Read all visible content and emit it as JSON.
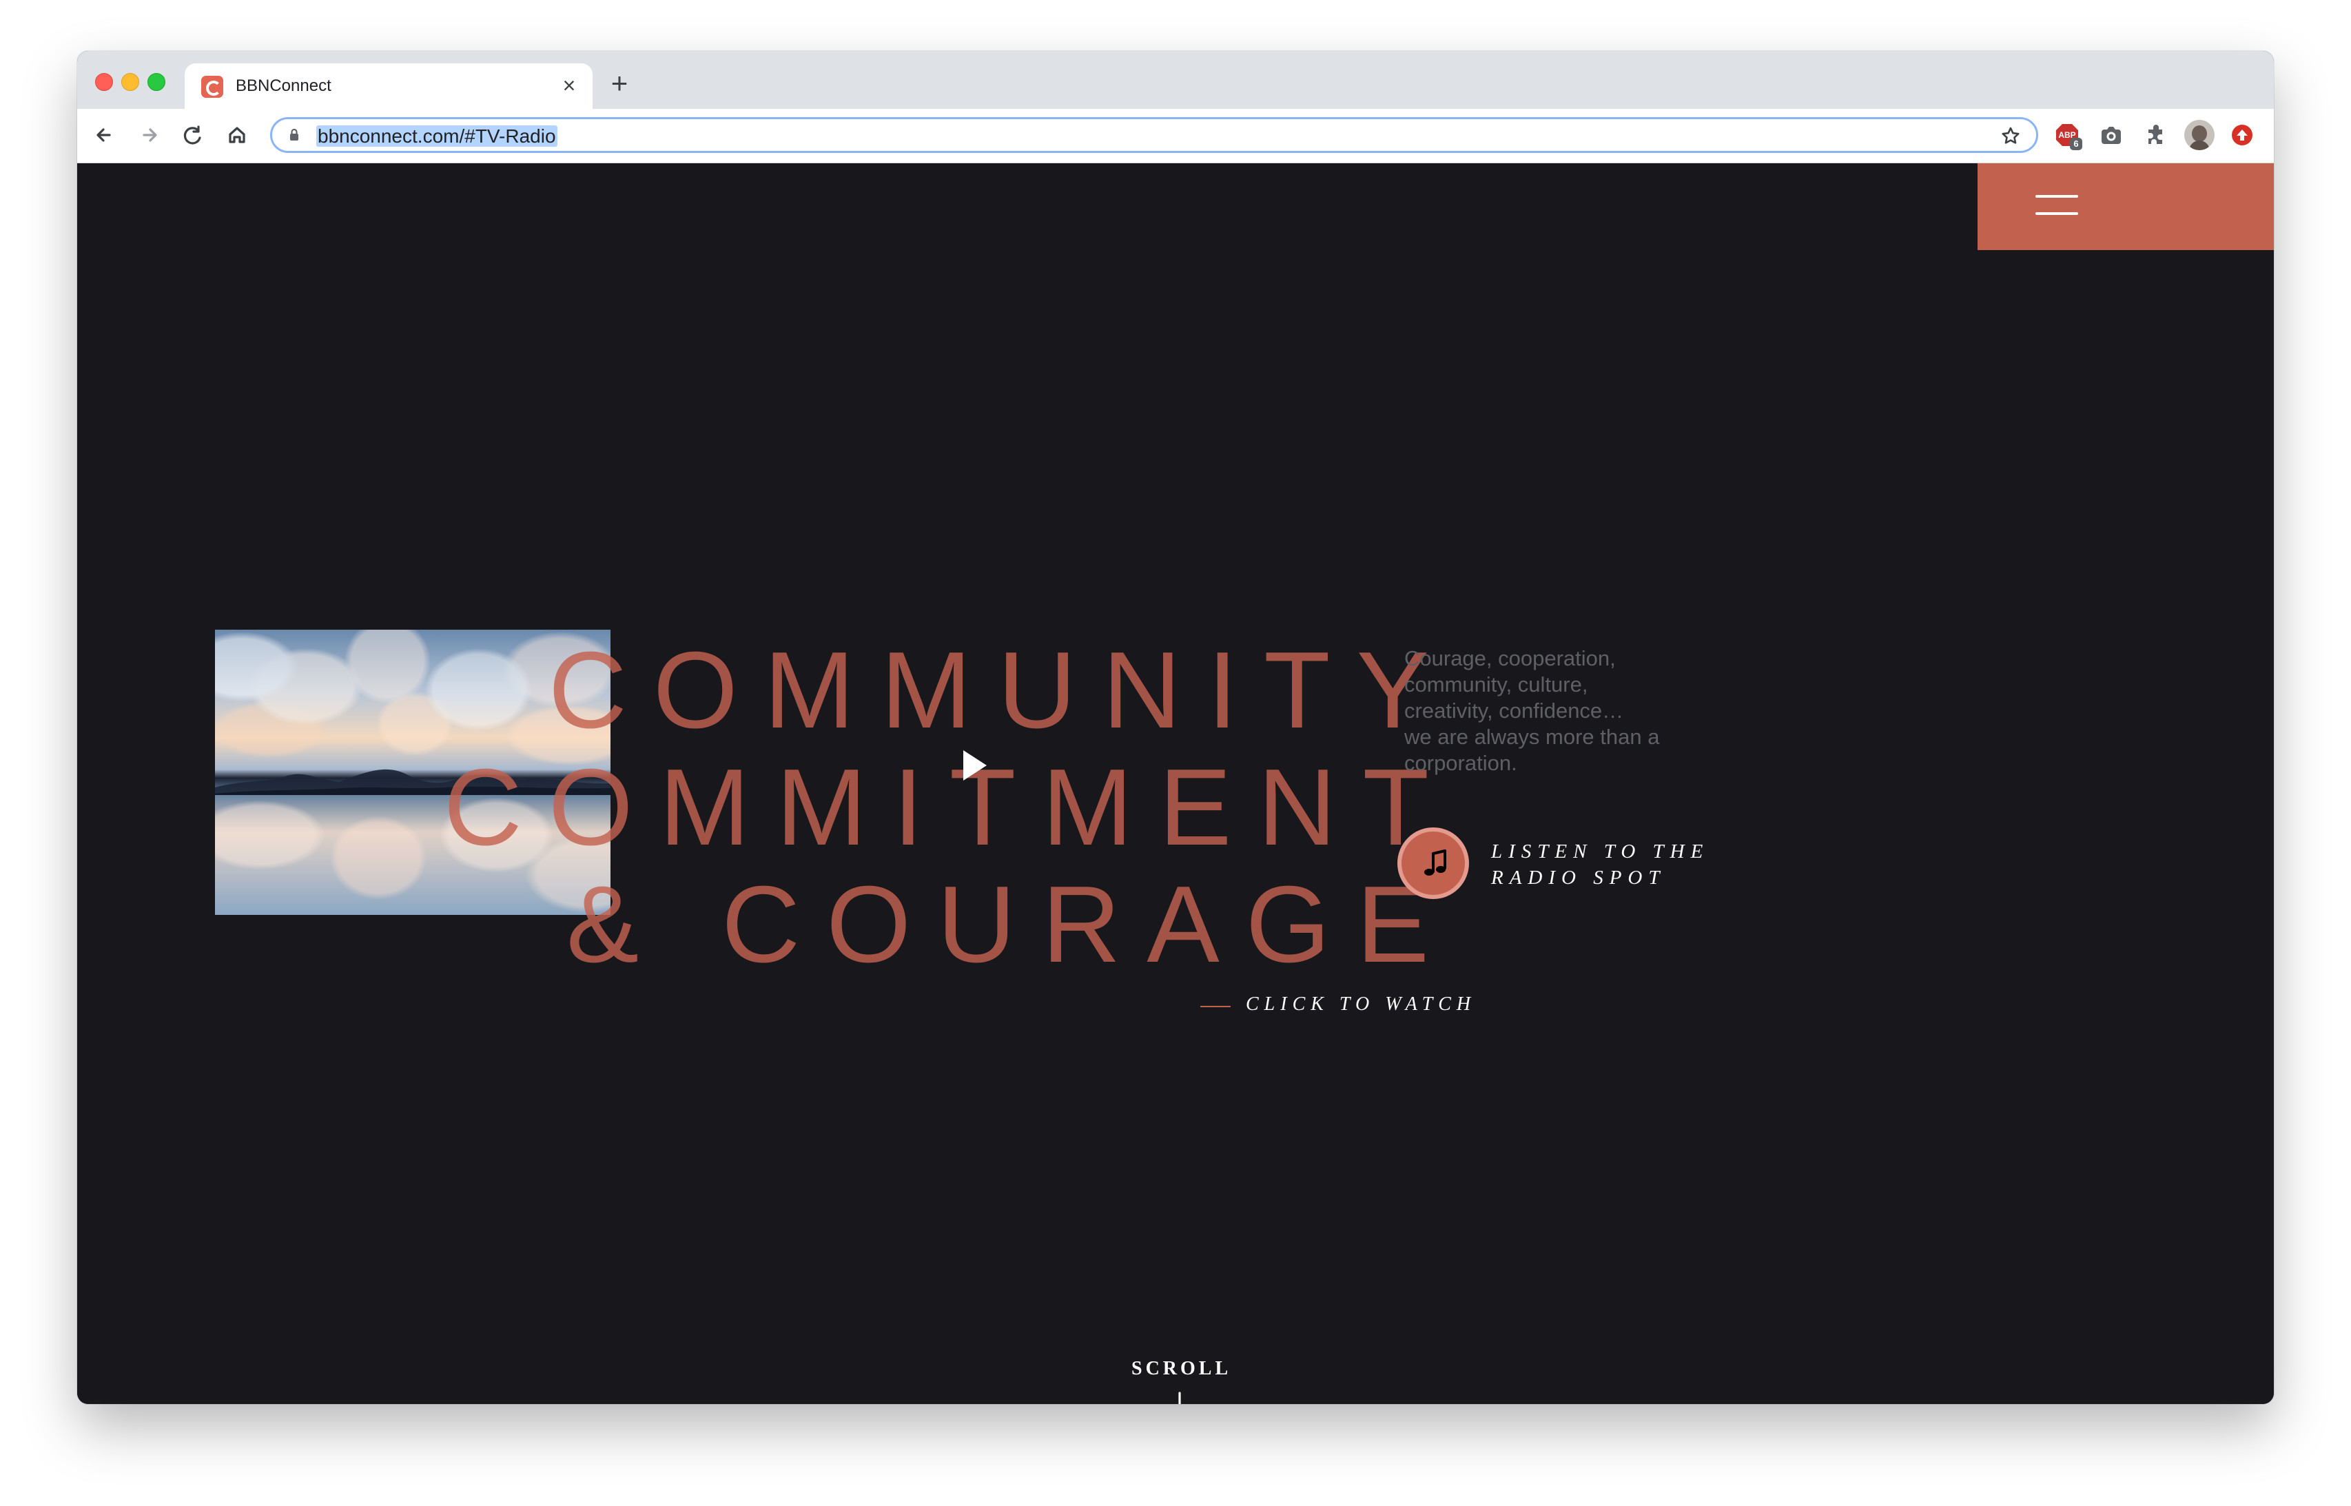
{
  "browser": {
    "tab_title": "BBNConnect",
    "close_symbol": "×",
    "new_tab_symbol": "+",
    "url": "bbnconnect.com/#TV-Radio",
    "ad_block_count": "6",
    "icons": {
      "favicon": "bbn-favicon-icon",
      "back": "arrow-left-icon",
      "forward": "arrow-right-icon",
      "reload": "reload-icon",
      "home": "home-icon",
      "secure": "lock-icon",
      "bookmark": "star-icon",
      "ad_block": "adblock-icon",
      "camera": "camera-icon",
      "extensions": "puzzle-icon",
      "profile": "avatar-icon",
      "update": "update-icon"
    }
  },
  "site": {
    "heading_lines": [
      "COMMUNITY",
      "COMMITMENT",
      "& COURAGE"
    ],
    "watch_label": "CLICK TO WATCH",
    "description_lines": [
      "Courage, cooperation,",
      "community, culture,",
      "creativity, confidence…",
      "we are always more than a",
      "corporation."
    ],
    "radio_lines": [
      "LISTEN TO THE",
      "RADIO SPOT"
    ],
    "scroll_label": "SCROLL",
    "icons": {
      "menu": "hamburger-menu-icon",
      "video_play": "play-icon",
      "radio": "music-note-icon",
      "scroll": "arrow-down-icon"
    },
    "colors": {
      "background": "#18181c",
      "accent": "#c3614f",
      "description": "#5f6066",
      "text": "#ffffff"
    }
  }
}
